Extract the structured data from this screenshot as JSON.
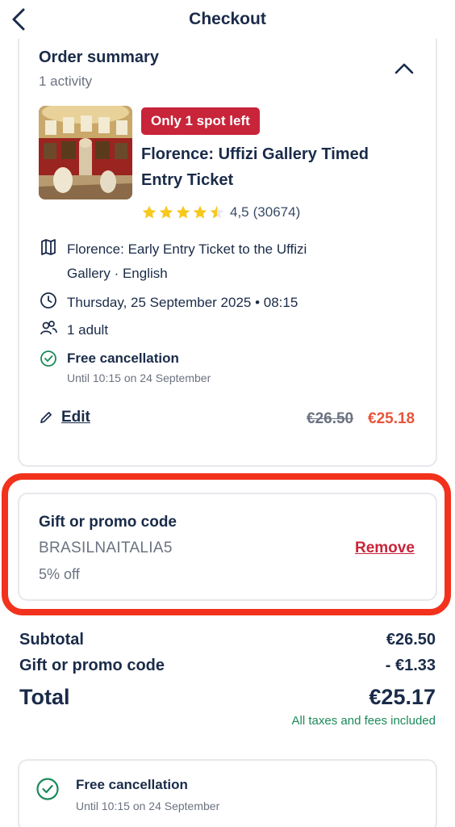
{
  "header": {
    "title": "Checkout"
  },
  "order": {
    "title": "Order summary",
    "subtitle": "1 activity",
    "badge": "Only 1 spot left",
    "activity_title": "Florence: Uffizi Gallery Timed Entry Ticket",
    "rating": {
      "score_text": "4,5",
      "count_text": "(30674)",
      "stars": 4.5
    },
    "option_line1": "Florence: Early Entry Ticket to the Uffizi",
    "option_line2": "Gallery · English",
    "date_time": "Thursday, 25 September 2025 • 08:15",
    "participants": "1 adult",
    "free_cancellation": "Free cancellation",
    "free_cancellation_until": "Until 10:15 on 24 September",
    "edit_label": "Edit",
    "price_old": "€26.50",
    "price_new": "€25.18"
  },
  "promo": {
    "title": "Gift or promo code",
    "code": "BRASILNAITALIA5",
    "discount": "5% off",
    "remove_label": "Remove"
  },
  "totals": {
    "subtotal_label": "Subtotal",
    "subtotal_value": "€26.50",
    "promo_label": "Gift or promo code",
    "promo_value": "- €1.33",
    "total_label": "Total",
    "total_value": "€25.17",
    "taxes_note": "All taxes and fees included"
  },
  "cancellation_card": {
    "title": "Free cancellation",
    "until": "Until 10:15 on 24 September"
  },
  "colors": {
    "primary_text": "#1a2b49",
    "badge_red": "#c8243a",
    "discount_price": "#e8553c",
    "highlight_red": "#f2321c",
    "success_green": "#1a8a5a",
    "star_gold": "#f7c81e"
  }
}
